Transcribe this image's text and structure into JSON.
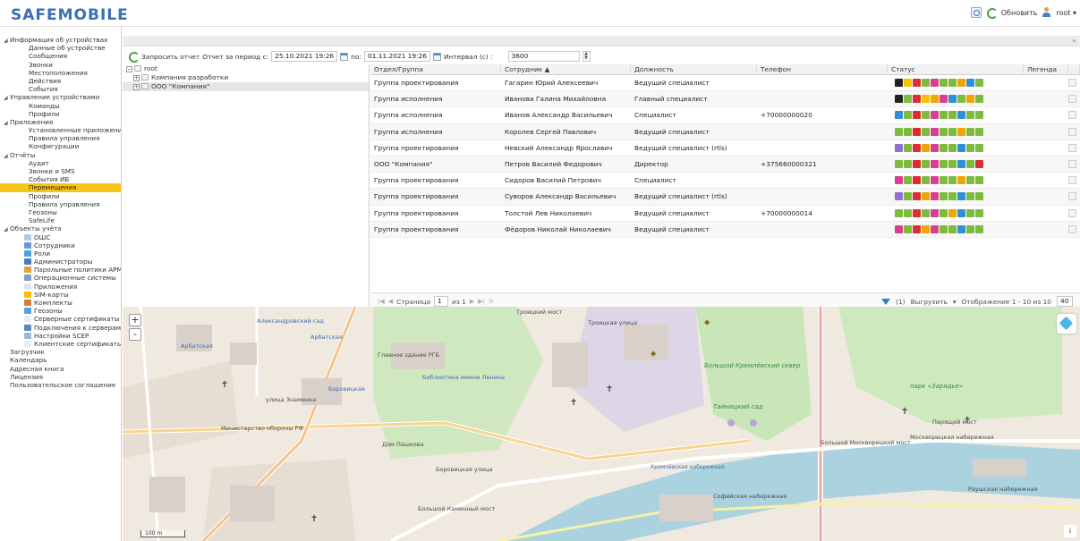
{
  "app": {
    "logo": "SAFEMOBILE"
  },
  "header": {
    "refresh_label": "Обновить",
    "user_label": "root ▾"
  },
  "sidebar": {
    "items": [
      {
        "label": "Информация об устройствах",
        "level": 0,
        "expanded": true
      },
      {
        "label": "Данные об устройстве",
        "level": 1
      },
      {
        "label": "Сообщения",
        "level": 1
      },
      {
        "label": "Звонки",
        "level": 1
      },
      {
        "label": "Местоположения",
        "level": 1
      },
      {
        "label": "Действия",
        "level": 1
      },
      {
        "label": "События",
        "level": 1
      },
      {
        "label": "Управление устройствами",
        "level": 0,
        "expanded": true
      },
      {
        "label": "Команды",
        "level": 1
      },
      {
        "label": "Профили",
        "level": 1
      },
      {
        "label": "Приложения",
        "level": 0,
        "expanded": true
      },
      {
        "label": "Установленные приложения",
        "level": 1
      },
      {
        "label": "Правила управления",
        "level": 1
      },
      {
        "label": "Конфигурации",
        "level": 1
      },
      {
        "label": "Отчёты",
        "level": 0,
        "expanded": true
      },
      {
        "label": "Аудит",
        "level": 1
      },
      {
        "label": "Звонки и SMS",
        "level": 1
      },
      {
        "label": "События ИБ",
        "level": 1
      },
      {
        "label": "Перемещения",
        "level": 1,
        "active": true
      },
      {
        "label": "Профили",
        "level": 1
      },
      {
        "label": "Правила управления",
        "level": 1
      },
      {
        "label": "Геозоны",
        "level": 1
      },
      {
        "label": "SafeLife",
        "level": 1
      },
      {
        "label": "Объекты учёта",
        "level": 0,
        "expanded": true
      },
      {
        "label": "ОШС",
        "level": 2,
        "icon": "org-tree-icon"
      },
      {
        "label": "Сотрудники",
        "level": 2,
        "icon": "employees-icon"
      },
      {
        "label": "Роли",
        "level": 2,
        "icon": "roles-icon"
      },
      {
        "label": "Администраторы",
        "level": 2,
        "icon": "admins-icon"
      },
      {
        "label": "Парольные политики АРМ",
        "level": 2,
        "icon": "password-policy-icon"
      },
      {
        "label": "Операционные системы",
        "level": 2,
        "icon": "os-icon"
      },
      {
        "label": "Приложения",
        "level": 2,
        "icon": "apps-icon"
      },
      {
        "label": "SIM-карты",
        "level": 2,
        "icon": "sim-card-icon"
      },
      {
        "label": "Комплекты",
        "level": 2,
        "icon": "kits-icon"
      },
      {
        "label": "Геозоны",
        "level": 2,
        "icon": "geozones-icon"
      },
      {
        "label": "Серверные сертификаты",
        "level": 2,
        "icon": "server-cert-icon"
      },
      {
        "label": "Подключения к серверам",
        "level": 2,
        "icon": "server-connection-icon"
      },
      {
        "label": "Настройки SCEP",
        "level": 2,
        "icon": "scep-settings-icon"
      },
      {
        "label": "Клиентские сертификаты",
        "level": 2,
        "icon": "client-cert-icon"
      },
      {
        "label": "Загрузчик",
        "level": 0
      },
      {
        "label": "Календарь",
        "level": 0
      },
      {
        "label": "Адресная книга",
        "level": 0
      },
      {
        "label": "Лицензия",
        "level": 0
      },
      {
        "label": "Пользовательское соглашение",
        "level": 0
      }
    ]
  },
  "toolbar": {
    "request_report": "Запросить отчет",
    "period_from_label": "Отчет за период с:",
    "period_from_value": "25.10.2021 19:26",
    "period_to_label": "по:",
    "period_to_value": "01.11.2021 19:26",
    "interval_label": "Интервал (с) :",
    "interval_value": "3600"
  },
  "tree": {
    "nodes": [
      {
        "label": "root",
        "depth": 0,
        "toggle": "⊟"
      },
      {
        "label": "Компания разработки",
        "depth": 1,
        "toggle": "⊞"
      },
      {
        "label": "ООО \"Компания\"",
        "depth": 1,
        "toggle": "⊞",
        "selected": true
      }
    ]
  },
  "grid": {
    "columns": [
      "Отдел/Группа",
      "Сотрудник ▲",
      "Должность",
      "Телефон",
      "Статус",
      "Легенда"
    ],
    "rows": [
      {
        "group": "Группа проектирования",
        "employee": "Гагарин Юрий Алексеевич",
        "position": "Ведущий специалист",
        "phone": "",
        "status": [
          "#222222",
          "#f2c200",
          "#d83030",
          "#7dbb3f",
          "#d83f8e",
          "#7dbb3f",
          "#7dbb3f",
          "#f2a400",
          "#2f8fd6",
          "#7dbb3f"
        ]
      },
      {
        "group": "Группа исполнения",
        "employee": "Иванова Галина Михайловна",
        "position": "Главный специалист",
        "phone": "",
        "status": [
          "#222222",
          "#7dbb3f",
          "#d83030",
          "#f2c200",
          "#f2a400",
          "#d83f8e",
          "#2f8fd6",
          "#7dbb3f",
          "#f2a400",
          "#7dbb3f"
        ]
      },
      {
        "group": "Группа исполнения",
        "employee": "Иванов Александр Васильевич",
        "position": "Специалист",
        "phone": "+70000000020",
        "status": [
          "#2f8fd6",
          "#7dbb3f",
          "#d83030",
          "#7dbb3f",
          "#d83f8e",
          "#7dbb3f",
          "#7dbb3f",
          "#2f8fd6",
          "#7dbb3f",
          "#7dbb3f"
        ]
      },
      {
        "group": "Группа исполнения",
        "employee": "Королев Сергей Павлович",
        "position": "Ведущий специалист",
        "phone": "",
        "status": [
          "#7dbb3f",
          "#7dbb3f",
          "#d83030",
          "#7dbb3f",
          "#d83f8e",
          "#7dbb3f",
          "#7dbb3f",
          "#f2a400",
          "#7dbb3f",
          "#7dbb3f"
        ]
      },
      {
        "group": "Группа проектирования",
        "employee": "Невский Александр Ярославич",
        "position": "Ведущий специалист (rtls)",
        "phone": "",
        "status": [
          "#8f6fcf",
          "#7dbb3f",
          "#d83030",
          "#f2a400",
          "#d83f8e",
          "#7dbb3f",
          "#7dbb3f",
          "#2f8fd6",
          "#7dbb3f",
          "#7dbb3f"
        ]
      },
      {
        "group": "ООО \"Компания\"",
        "employee": "Петров Василий Федорович",
        "position": "Директор",
        "phone": "+375660000321",
        "status": [
          "#7dbb3f",
          "#7dbb3f",
          "#d83030",
          "#7dbb3f",
          "#d83f8e",
          "#7dbb3f",
          "#7dbb3f",
          "#2f8fd6",
          "#7dbb3f",
          "#d83030"
        ]
      },
      {
        "group": "Группа проектирования",
        "employee": "Сидоров Василий Петрович",
        "position": "Специалист",
        "phone": "",
        "status": [
          "#d83f8e",
          "#7dbb3f",
          "#d83030",
          "#7dbb3f",
          "#d83f8e",
          "#7dbb3f",
          "#7dbb3f",
          "#f2a400",
          "#7dbb3f",
          "#7dbb3f"
        ]
      },
      {
        "group": "Группа проектирования",
        "employee": "Суворов Александр Васильевич",
        "position": "Ведущий специалист (rtls)",
        "phone": "",
        "status": [
          "#8f6fcf",
          "#7dbb3f",
          "#d83030",
          "#f2a400",
          "#d83f8e",
          "#7dbb3f",
          "#7dbb3f",
          "#2f8fd6",
          "#7dbb3f",
          "#7dbb3f"
        ]
      },
      {
        "group": "Группа проектирования",
        "employee": "Толстой Лев Николаевич",
        "position": "Ведущий специалист",
        "phone": "+70000000014",
        "status": [
          "#7dbb3f",
          "#7dbb3f",
          "#d83030",
          "#7dbb3f",
          "#d83f8e",
          "#7dbb3f",
          "#f2a400",
          "#2f8fd6",
          "#7dbb3f",
          "#7dbb3f"
        ]
      },
      {
        "group": "Группа проектирования",
        "employee": "Фёдоров Николай Николаевич",
        "position": "Ведущий специалист",
        "phone": "",
        "status": [
          "#d83f8e",
          "#7dbb3f",
          "#d83030",
          "#f2a400",
          "#d83f8e",
          "#7dbb3f",
          "#7dbb3f",
          "#2f8fd6",
          "#7dbb3f",
          "#7dbb3f"
        ]
      }
    ]
  },
  "pager": {
    "page_label": "Страница",
    "page_value": "1",
    "of_label": "из 1",
    "filter_count": "(1)",
    "export_label": "Выгрузить",
    "display_label": "Отображение 1 - 10 из 10",
    "page_size": "40"
  },
  "map": {
    "zoom_in": "+",
    "zoom_out": "-",
    "scale_label": "100 m",
    "info": "i",
    "labels": [
      {
        "text": "Александровский сад",
        "cls": "blue"
      },
      {
        "text": "Арбатская",
        "cls": "blue"
      },
      {
        "text": "Арбатская",
        "cls": "blue"
      },
      {
        "text": "Библиотека имени Ленина",
        "cls": "blue"
      },
      {
        "text": "Боровицкая",
        "cls": "blue"
      },
      {
        "text": "Главное здание РГБ",
        "cls": ""
      },
      {
        "text": "Министерство обороны РФ",
        "cls": ""
      },
      {
        "text": "Дом Пашкова",
        "cls": ""
      },
      {
        "text": "Троицкий мост",
        "cls": ""
      },
      {
        "text": "Троицкая улица",
        "cls": ""
      },
      {
        "text": "Большой Кремлёвский сквер",
        "cls": "green"
      },
      {
        "text": "Тайницкий сад",
        "cls": "green"
      },
      {
        "text": "парк «Зарядье»",
        "cls": "green"
      },
      {
        "text": "Парящий мост",
        "cls": ""
      },
      {
        "text": "Москворецкая набережная",
        "cls": ""
      },
      {
        "text": "Большой Москворецкий мост",
        "cls": ""
      },
      {
        "text": "Кремлёвская набережная",
        "cls": "river"
      },
      {
        "text": "Софийская набережная",
        "cls": ""
      },
      {
        "text": "Боровицкая улица",
        "cls": ""
      },
      {
        "text": "улица Знаменка",
        "cls": ""
      },
      {
        "text": "Раушская набережная",
        "cls": ""
      },
      {
        "text": "Большой Каменный мост",
        "cls": ""
      }
    ]
  }
}
